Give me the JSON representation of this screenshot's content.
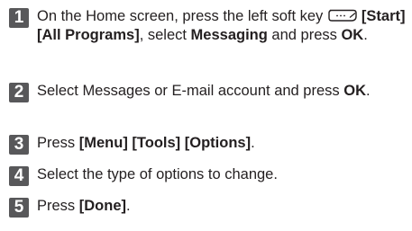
{
  "steps": [
    {
      "num": "1",
      "p1": "On the Home screen, press the left soft key ",
      "key_icon": "soft-key-icon",
      "b1": "[Start] [All Programs]",
      "p2": ", select ",
      "b2": "Messaging",
      "p3": " and press ",
      "b3": "OK",
      "p4": "."
    },
    {
      "num": "2",
      "p1": "Select Messages or E-mail account and press ",
      "b1": "OK",
      "p2": "."
    },
    {
      "num": "3",
      "p1": "Press ",
      "b1": "[Menu] [Tools] [Options]",
      "p2": "."
    },
    {
      "num": "4",
      "p1": "Select the type of options to change."
    },
    {
      "num": "5",
      "p1": "Press ",
      "b1": "[Done]",
      "p2": "."
    }
  ],
  "colors": {
    "badge": "#58585a",
    "text": "#231f20"
  }
}
